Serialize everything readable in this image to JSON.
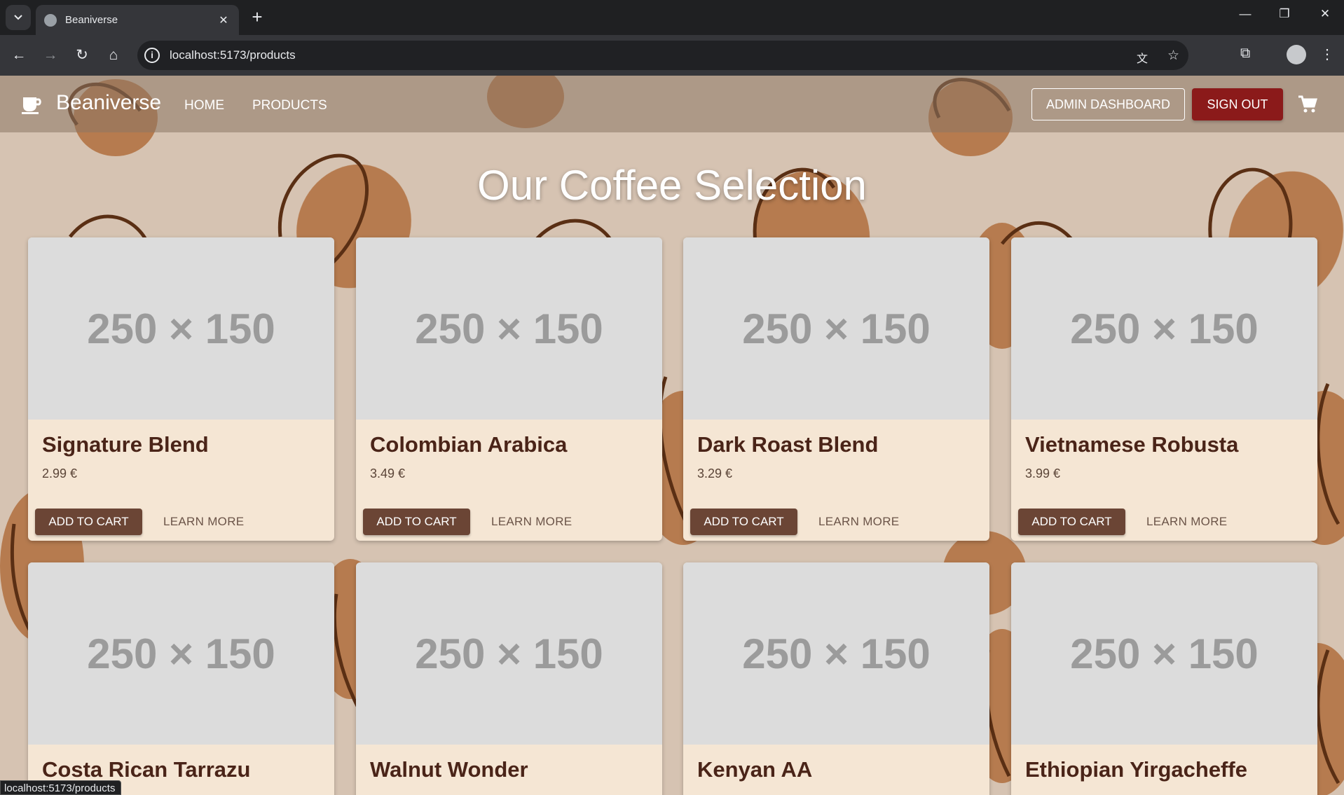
{
  "browser": {
    "tab_title": "Beaniverse",
    "url": "localhost:5173/products",
    "status_url": "localhost:5173/products"
  },
  "appbar": {
    "brand": "Beaniverse",
    "nav": [
      "HOME",
      "PRODUCTS"
    ],
    "admin_label": "ADMIN DASHBOARD",
    "signout_label": "SIGN OUT"
  },
  "heading": "Our Coffee Selection",
  "products": [
    {
      "image_placeholder": "250 × 150",
      "name": "Signature Blend",
      "price": "2.99 €",
      "add_label": "ADD TO CART",
      "learn_label": "LEARN MORE"
    },
    {
      "image_placeholder": "250 × 150",
      "name": "Colombian Arabica",
      "price": "3.49 €",
      "add_label": "ADD TO CART",
      "learn_label": "LEARN MORE"
    },
    {
      "image_placeholder": "250 × 150",
      "name": "Dark Roast Blend",
      "price": "3.29 €",
      "add_label": "ADD TO CART",
      "learn_label": "LEARN MORE"
    },
    {
      "image_placeholder": "250 × 150",
      "name": "Vietnamese Robusta",
      "price": "3.99 €",
      "add_label": "ADD TO CART",
      "learn_label": "LEARN MORE"
    },
    {
      "image_placeholder": "250 × 150",
      "name": "Costa Rican Tarrazu"
    },
    {
      "image_placeholder": "250 × 150",
      "name": "Walnut Wonder"
    },
    {
      "image_placeholder": "250 × 150",
      "name": "Kenyan AA"
    },
    {
      "image_placeholder": "250 × 150",
      "name": "Ethiopian Yirgacheffe"
    }
  ],
  "colors": {
    "accent_brown": "#6b4535",
    "signout_red": "#8b1a1a",
    "card_bg": "#f5e6d4",
    "page_bg": "#d6c3b2"
  },
  "icons": [
    "tab-search-icon",
    "globe-icon",
    "close-icon",
    "plus-icon",
    "minimize-icon",
    "restore-icon",
    "back-icon",
    "forward-icon",
    "reload-icon",
    "home-icon",
    "info-icon",
    "translate-icon",
    "star-icon",
    "extensions-icon",
    "coffee-cup-icon",
    "cart-icon"
  ]
}
